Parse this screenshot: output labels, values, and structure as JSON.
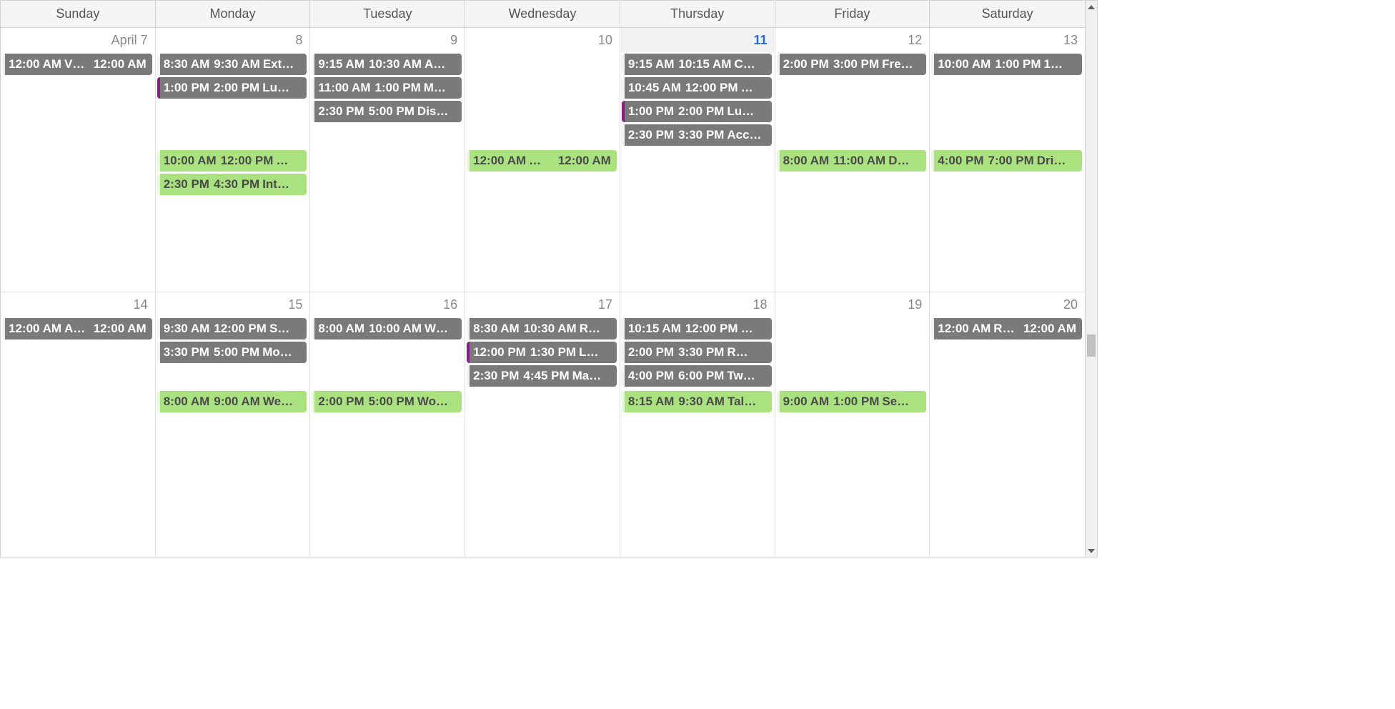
{
  "days_of_week": [
    "Sunday",
    "Monday",
    "Tuesday",
    "Wednesday",
    "Thursday",
    "Friday",
    "Saturday"
  ],
  "weeks": [
    {
      "cells": [
        {
          "date_label": "April 7",
          "today": false,
          "gray": [
            {
              "t1": "12:00 AM",
              "title": "V…",
              "t2": "12:00 AM",
              "split": true
            }
          ],
          "green": []
        },
        {
          "date_label": "8",
          "today": false,
          "gray": [
            {
              "t1": "8:30 AM",
              "t2": "9:30 AM",
              "title": "Ext…"
            },
            {
              "t1": "1:00 PM",
              "t2": "2:00 PM",
              "title": "Lu…",
              "stripe": "purple"
            }
          ],
          "green": [
            {
              "t1": "10:00 AM",
              "t2": "12:00 PM",
              "title": "…"
            },
            {
              "t1": "2:30 PM",
              "t2": "4:30 PM",
              "title": "Int…"
            }
          ]
        },
        {
          "date_label": "9",
          "today": false,
          "gray": [
            {
              "t1": "9:15 AM",
              "t2": "10:30 AM",
              "title": "A…"
            },
            {
              "t1": "11:00 AM",
              "t2": "1:00 PM",
              "title": "M…"
            },
            {
              "t1": "2:30 PM",
              "t2": "5:00 PM",
              "title": "Dis…"
            }
          ],
          "green": []
        },
        {
          "date_label": "10",
          "today": false,
          "gray": [],
          "green": [
            {
              "t1": "12:00 AM",
              "title": "…",
              "t2": "12:00 AM",
              "split": true
            }
          ]
        },
        {
          "date_label": "11",
          "today": true,
          "gray": [
            {
              "t1": "9:15 AM",
              "t2": "10:15 AM",
              "title": "C…"
            },
            {
              "t1": "10:45 AM",
              "t2": "12:00 PM",
              "title": "…"
            },
            {
              "t1": "1:00 PM",
              "t2": "2:00 PM",
              "title": "Lu…",
              "stripe": "purple"
            },
            {
              "t1": "2:30 PM",
              "t2": "3:30 PM",
              "title": "Acc…"
            }
          ],
          "green": []
        },
        {
          "date_label": "12",
          "today": false,
          "gray": [
            {
              "t1": "2:00 PM",
              "t2": "3:00 PM",
              "title": "Fre…"
            }
          ],
          "green": [
            {
              "t1": "8:00 AM",
              "t2": "11:00 AM",
              "title": "D…"
            }
          ]
        },
        {
          "date_label": "13",
          "today": false,
          "gray": [
            {
              "t1": "10:00 AM",
              "t2": "1:00 PM",
              "title": "1…"
            }
          ],
          "green": [
            {
              "t1": "4:00 PM",
              "t2": "7:00 PM",
              "title": "Dri…"
            }
          ]
        }
      ]
    },
    {
      "cells": [
        {
          "date_label": "14",
          "today": false,
          "gray": [
            {
              "t1": "12:00 AM",
              "title": "A…",
              "t2": "12:00 AM",
              "split": true
            }
          ],
          "green": []
        },
        {
          "date_label": "15",
          "today": false,
          "gray": [
            {
              "t1": "9:30 AM",
              "t2": "12:00 PM",
              "title": "S…"
            },
            {
              "t1": "3:30 PM",
              "t2": "5:00 PM",
              "title": "Mo…"
            }
          ],
          "green": [
            {
              "t1": "8:00 AM",
              "t2": "9:00 AM",
              "title": "We…"
            }
          ]
        },
        {
          "date_label": "16",
          "today": false,
          "gray": [
            {
              "t1": "8:00 AM",
              "t2": "10:00 AM",
              "title": "W…"
            }
          ],
          "green": [
            {
              "t1": "2:00 PM",
              "t2": "5:00 PM",
              "title": "Wo…"
            }
          ]
        },
        {
          "date_label": "17",
          "today": false,
          "gray": [
            {
              "t1": "8:30 AM",
              "t2": "10:30 AM",
              "title": "R…"
            },
            {
              "t1": "12:00 PM",
              "t2": "1:30 PM",
              "title": "L…",
              "stripe": "purple"
            },
            {
              "t1": "2:30 PM",
              "t2": "4:45 PM",
              "title": "Ma…"
            }
          ],
          "green": []
        },
        {
          "date_label": "18",
          "today": false,
          "gray": [
            {
              "t1": "10:15 AM",
              "t2": "12:00 PM",
              "title": "…"
            },
            {
              "t1": "2:00 PM",
              "t2": "3:30 PM",
              "title": "R…"
            },
            {
              "t1": "4:00 PM",
              "t2": "6:00 PM",
              "title": "Tw…"
            }
          ],
          "green": [
            {
              "t1": "8:15 AM",
              "t2": "9:30 AM",
              "title": "Tal…"
            }
          ]
        },
        {
          "date_label": "19",
          "today": false,
          "gray": [],
          "green": [
            {
              "t1": "9:00 AM",
              "t2": "1:00 PM",
              "title": "Se…"
            }
          ]
        },
        {
          "date_label": "20",
          "today": false,
          "gray": [
            {
              "t1": "12:00 AM",
              "title": "R…",
              "t2": "12:00 AM",
              "split": true
            }
          ],
          "green": []
        }
      ]
    }
  ],
  "scrollbar": {
    "thumb_top_pct": 60,
    "thumb_height_pct": 4
  }
}
